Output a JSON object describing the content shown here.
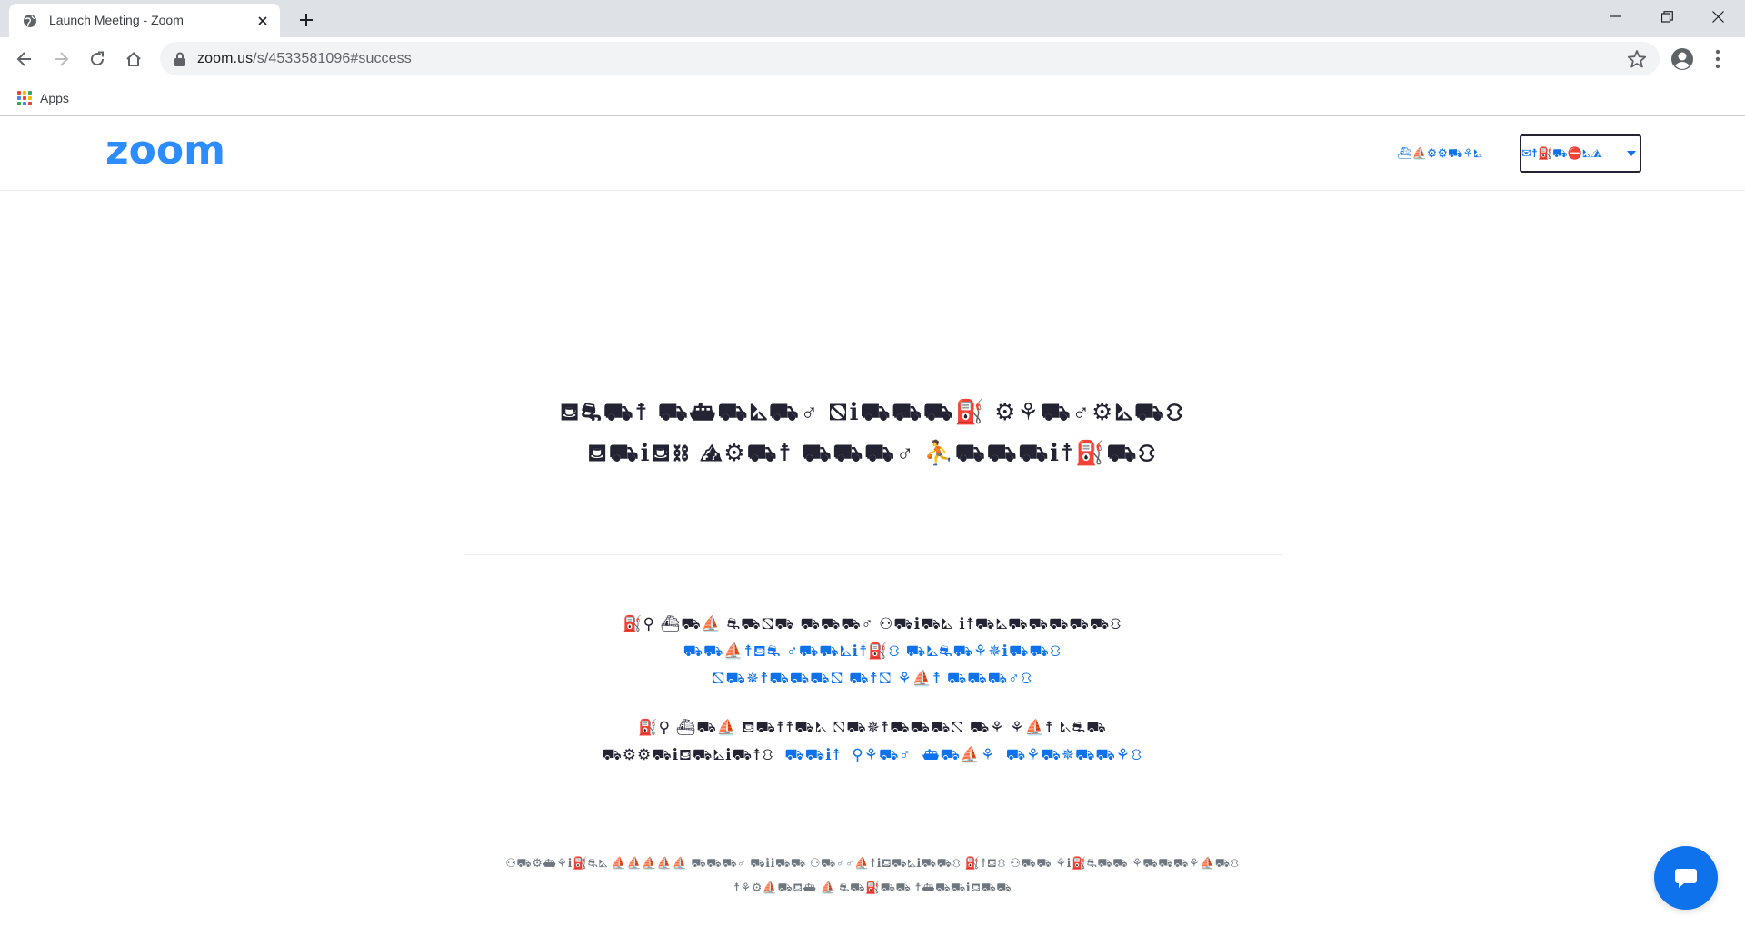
{
  "browser": {
    "tab": {
      "title": "Launch Meeting - Zoom"
    },
    "address_bar": {
      "url_host": "zoom.us",
      "url_path": "/s/4533581096#success"
    },
    "bookmarks": [
      {
        "label": "Apps"
      }
    ]
  },
  "header": {
    "logo_text": "zoom",
    "support_link": "⛴⛵⚙⚙⛟⚘⛡",
    "language_select": {
      "value": "✉☨⛽⛟⛔⛡⛰"
    }
  },
  "main": {
    "message_lines": [
      "⛾⛐⛟☨ ⛟⛴⛟⛡⛟♂ ⛞ℹ⛟⛟⛟⛽ ⚙⚘⛟♂⚙⛡⛟⛻",
      "⛾⛟ℹ⛾⛓ ⛰⚙⛟☨ ⛟⛟⛟♂ ⛹⛟⛟⛟ℹ☨⛽⛟⛻"
    ],
    "info_block_1": {
      "line1_text": "⛽⚲ ⛴⛟⛵ ⛐⛟⛞⛟ ⛟⛟⛟♂ ⚇⛟ℹ⛟⛡ ℹ☨⛟⛡⛟⛟⛟⛟⛟⛻",
      "line2_link": "⛟⛟⛵☨⛾⛐ ♂⛟⛟⛡ℹ☨⛽⛻ ⛟⛡⛐⛟⚘✵ℹ⛟⛟⛻",
      "line3_link": "⛞⛟✵☨⛟⛟⛟⛞ ⛟☨⛞ ⚘⛵☨ ⛟⛟⛟♂⛻"
    },
    "info_block_2": {
      "line1_text": "⛽⚲ ⛴⛟⛵ ⛾⛟☨☨⛟⛡ ⛞⛟✵☨⛟⛟⛟⛞ ⛟⚘ ⚘⛵☨ ⛡⛐⛟",
      "line2_text": "⛟⚙⚙⛟ℹ⛾⛟⛡ℹ⛟☨⛻",
      "line2_link_a": "⛟⛟ℹ☨",
      "line2_link_b": "⚲⚘⛟♂",
      "line2_link_c": "⛴⛟⛵⚘",
      "line2_link_d": "⛟⚘⛟✵⛟⛟⚘⛻"
    }
  },
  "footer": {
    "line1": "⚇⛟⚙⛴⚘ℹ⛽⛐⛡ ⛵⛵⛵⛵⛵ ⛟⛟⛟♂ ⛟ℹℹ⛟⛟ ⚇⛟♂♂⛵☨ℹ⛾⛟⛡ℹ⛟⛟⛻ ⛽☨⛾⛻ ⚇⛟⛟ ⚘ℹ⛽⛐⛟⛟ ⚘⛟⛟⛟⚘⛵⛟⛻",
    "line2": "☨⚘⚙⛵⛟⛾⛴ ⛵ ⛐⛟⛽⛟⛟ ☨⛴⛟⛟ℹ⛾⛟⛟"
  },
  "colors": {
    "brand_blue": "#0e72ed",
    "text_dark": "#232333",
    "chrome_tabstrip": "#dee1e6",
    "omnibox_bg": "#f1f3f4"
  },
  "icons": [
    "globe-icon",
    "close-icon",
    "plus-icon",
    "minimize-icon",
    "restore-icon",
    "back-arrow-icon",
    "forward-arrow-icon",
    "reload-icon",
    "home-icon",
    "lock-icon",
    "star-icon",
    "profile-icon",
    "kebab-menu-icon",
    "apps-grid-icon",
    "chevron-down-icon",
    "chat-bubble-icon"
  ]
}
